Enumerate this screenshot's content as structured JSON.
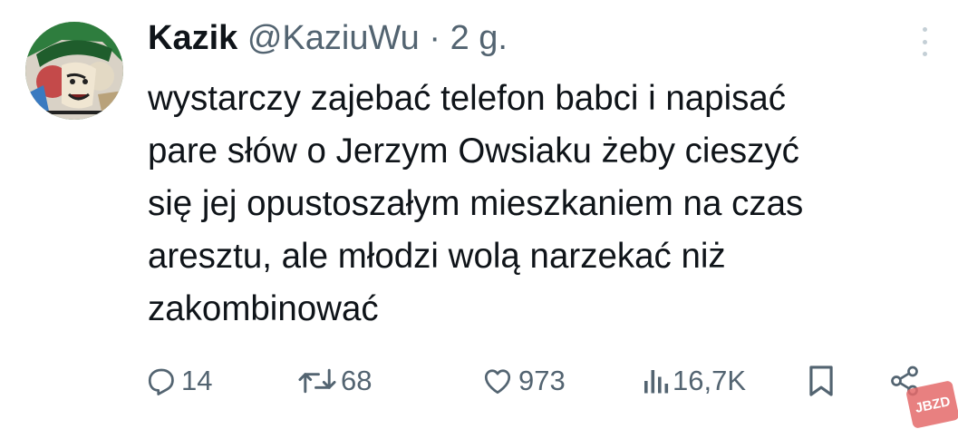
{
  "tweet": {
    "author_name": "Kazik",
    "handle": "@KaziuWu",
    "separator": "·",
    "timestamp": "2 g.",
    "text": "wystarczy zajebać telefon babci i napisać\npare słów o Jerzym Owsiaku żeby cieszyć\nsię jej opustoszałym mieszkaniem na czas\naresztu, ale młodzi wolą narzekać niż\nzakombinować"
  },
  "actions": {
    "replies": "14",
    "reposts": "68",
    "likes": "973",
    "views": "16,7K"
  },
  "icons": {
    "reply": "speech-bubble-icon",
    "repost": "repost-arrows-icon",
    "like": "heart-icon",
    "views": "bar-chart-icon",
    "bookmark": "bookmark-icon",
    "share": "share-nodes-icon",
    "more": "vertical-dots-icon"
  },
  "colors": {
    "text": "#0f1419",
    "secondary": "#536471"
  },
  "watermark": "JBZD"
}
